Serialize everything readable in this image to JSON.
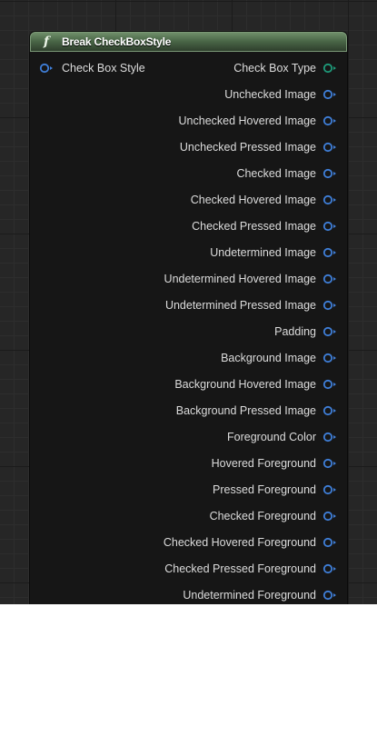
{
  "node": {
    "title": "Break CheckBoxStyle",
    "icon": "function-icon",
    "header_color": "#4b6848",
    "input": {
      "label": "Check Box Style",
      "pin_color": "#3f7fd9"
    },
    "outputs": [
      {
        "label": "Check Box Type",
        "pin_color": "#1e9b7a"
      },
      {
        "label": "Unchecked Image",
        "pin_color": "#3f7fd9"
      },
      {
        "label": "Unchecked Hovered Image",
        "pin_color": "#3f7fd9"
      },
      {
        "label": "Unchecked Pressed Image",
        "pin_color": "#3f7fd9"
      },
      {
        "label": "Checked Image",
        "pin_color": "#3f7fd9"
      },
      {
        "label": "Checked Hovered Image",
        "pin_color": "#3f7fd9"
      },
      {
        "label": "Checked Pressed Image",
        "pin_color": "#3f7fd9"
      },
      {
        "label": "Undetermined Image",
        "pin_color": "#3f7fd9"
      },
      {
        "label": "Undetermined Hovered Image",
        "pin_color": "#3f7fd9"
      },
      {
        "label": "Undetermined Pressed Image",
        "pin_color": "#3f7fd9"
      },
      {
        "label": "Padding",
        "pin_color": "#3f7fd9"
      },
      {
        "label": "Background Image",
        "pin_color": "#3f7fd9"
      },
      {
        "label": "Background Hovered Image",
        "pin_color": "#3f7fd9"
      },
      {
        "label": "Background Pressed Image",
        "pin_color": "#3f7fd9"
      },
      {
        "label": "Foreground Color",
        "pin_color": "#3f7fd9"
      },
      {
        "label": "Hovered Foreground",
        "pin_color": "#3f7fd9"
      },
      {
        "label": "Pressed Foreground",
        "pin_color": "#3f7fd9"
      },
      {
        "label": "Checked Foreground",
        "pin_color": "#3f7fd9"
      },
      {
        "label": "Checked Hovered Foreground",
        "pin_color": "#3f7fd9"
      },
      {
        "label": "Checked Pressed Foreground",
        "pin_color": "#3f7fd9"
      },
      {
        "label": "Undetermined Foreground",
        "pin_color": "#3f7fd9"
      }
    ]
  }
}
